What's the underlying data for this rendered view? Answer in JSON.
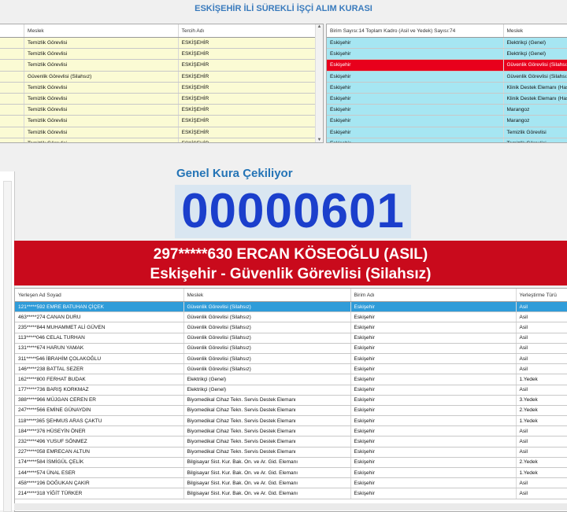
{
  "title": "ESKİŞEHİR İLİ SÜREKLİ İŞÇİ ALIM KURASI",
  "left_grid": {
    "headers": [
      "Meslek",
      "Tercih Adı"
    ],
    "rows": [
      [
        "Temizlik Görevlisi",
        "ESKİŞEHİR"
      ],
      [
        "Temizlik Görevlisi",
        "ESKİŞEHİR"
      ],
      [
        "Temizlik Görevlisi",
        "ESKİŞEHİR"
      ],
      [
        "Güvenlik Görevlisi (Silahsız)",
        "ESKİŞEHİR"
      ],
      [
        "Temizlik Görevlisi",
        "ESKİŞEHİR"
      ],
      [
        "Temizlik Görevlisi",
        "ESKİŞEHİR"
      ],
      [
        "Temizlik Görevlisi",
        "ESKİŞEHİR"
      ],
      [
        "Temizlik Görevlisi",
        "ESKİŞEHİR"
      ],
      [
        "Temizlik Görevlisi",
        "ESKİŞEHİR"
      ],
      [
        "Temizlik Görevlisi",
        "ESKİŞEHİR"
      ]
    ]
  },
  "right_grid": {
    "headers": [
      "Birim Sayısı:14 Toplam Kadro (Asil ve Yedek) Sayısı:74",
      "Meslek"
    ],
    "selected_index": 2,
    "rows": [
      [
        "Eskişehir",
        "Elektrikçi (Genel)"
      ],
      [
        "Eskişehir",
        "Elektrikçi (Genel)"
      ],
      [
        "Eskişehir",
        "Güvenlik Görevlisi (Silahsız)"
      ],
      [
        "Eskişehir",
        "Güvenlik Görevlisi (Silahsız)"
      ],
      [
        "Eskişehir",
        "Klinik Destek Elemanı (Hasta"
      ],
      [
        "Eskişehir",
        "Klinik Destek Elemanı (Hasta"
      ],
      [
        "Eskişehir",
        "Marangoz"
      ],
      [
        "Eskişehir",
        "Marangoz"
      ],
      [
        "Eskişehir",
        "Temizlik Görevlisi"
      ],
      [
        "Eskişehir",
        "Temizlik Görevlisi"
      ]
    ]
  },
  "draw": {
    "label": "Genel Kura Çekiliyor",
    "number": "00000601",
    "winner_line1": "297*****630 ERCAN KÖSEOĞLU (ASIL)",
    "winner_line2": "Eskişehir - Güvenlik Görevlisi (Silahsız)"
  },
  "bottom_grid": {
    "headers": [
      "Yerleşen Ad Soyad",
      "Meslek",
      "Birim Adı",
      "Yerleştirme Türü"
    ],
    "selected_index": 0,
    "rows": [
      [
        "121*****592 EMRE BATUHAN ÇİÇEK",
        "Güvenlik Görevlisi (Silahsız)",
        "Eskişehir",
        "Asil"
      ],
      [
        "463*****274 CANAN DURU",
        "Güvenlik Görevlisi (Silahsız)",
        "Eskişehir",
        "Asil"
      ],
      [
        "235*****844 MUHAMMET ALİ GÜVEN",
        "Güvenlik Görevlisi (Silahsız)",
        "Eskişehir",
        "Asil"
      ],
      [
        "113*****046 CELAL TURHAN",
        "Güvenlik Görevlisi (Silahsız)",
        "Eskişehir",
        "Asil"
      ],
      [
        "131*****674 HARUN YAMAK",
        "Güvenlik Görevlisi (Silahsız)",
        "Eskişehir",
        "Asil"
      ],
      [
        "311*****546 İBRAHİM ÇOLAKOĞLU",
        "Güvenlik Görevlisi (Silahsız)",
        "Eskişehir",
        "Asil"
      ],
      [
        "146*****238 BATTAL SEZER",
        "Güvenlik Görevlisi (Silahsız)",
        "Eskişehir",
        "Asil"
      ],
      [
        "162*****800 FERHAT BUDAK",
        "Elektrikçi (Genel)",
        "Eskişehir",
        "1.Yedek"
      ],
      [
        "177*****736 BARIŞ KORKMAZ",
        "Elektrikçi (Genel)",
        "Eskişehir",
        "Asil"
      ],
      [
        "388*****966 MÜJGAN CEREN ER",
        "Biyomedikal Cihaz Tekn. Servis Destek Elemanı",
        "Eskişehir",
        "3.Yedek"
      ],
      [
        "247*****566 EMİNE GÜNAYDIN",
        "Biyomedikal Cihaz Tekn. Servis Destek Elemanı",
        "Eskişehir",
        "2.Yedek"
      ],
      [
        "118*****365 ŞEHMUS ARAS ÇAKTU",
        "Biyomedikal Cihaz Tekn. Servis Destek Elemanı",
        "Eskişehir",
        "1.Yedek"
      ],
      [
        "184*****376 HÜSEYİN ÖNER",
        "Biyomedikal Cihaz Tekn. Servis Destek Elemanı",
        "Eskişehir",
        "Asil"
      ],
      [
        "232*****496 YUSUF SÖNMEZ",
        "Biyomedikal Cihaz Tekn. Servis Destek Elemanı",
        "Eskişehir",
        "Asil"
      ],
      [
        "227*****058 EMRECAN ALTUN",
        "Biyomedikal Cihaz Tekn. Servis Destek Elemanı",
        "Eskişehir",
        "Asil"
      ],
      [
        "174*****584 İSMİGÜL ÇELİK",
        "Bilgisayar Sist. Kur. Bak. On. ve Ar. Gid. Elemanı",
        "Eskişehir",
        "2.Yedek"
      ],
      [
        "144*****574 ÜNAL ESER",
        "Bilgisayar Sist. Kur. Bak. On. ve Ar. Gid. Elemanı",
        "Eskişehir",
        "1.Yedek"
      ],
      [
        "458*****196 DOĞUKAN ÇAKIR",
        "Bilgisayar Sist. Kur. Bak. On. ve Ar. Gid. Elemanı",
        "Eskişehir",
        "Asil"
      ],
      [
        "214*****318 YİĞİT TÜRKER",
        "Bilgisayar Sist. Kur. Bak. On. ve Ar. Gid. Elemanı",
        "Eskişehir",
        "Asil"
      ]
    ]
  }
}
